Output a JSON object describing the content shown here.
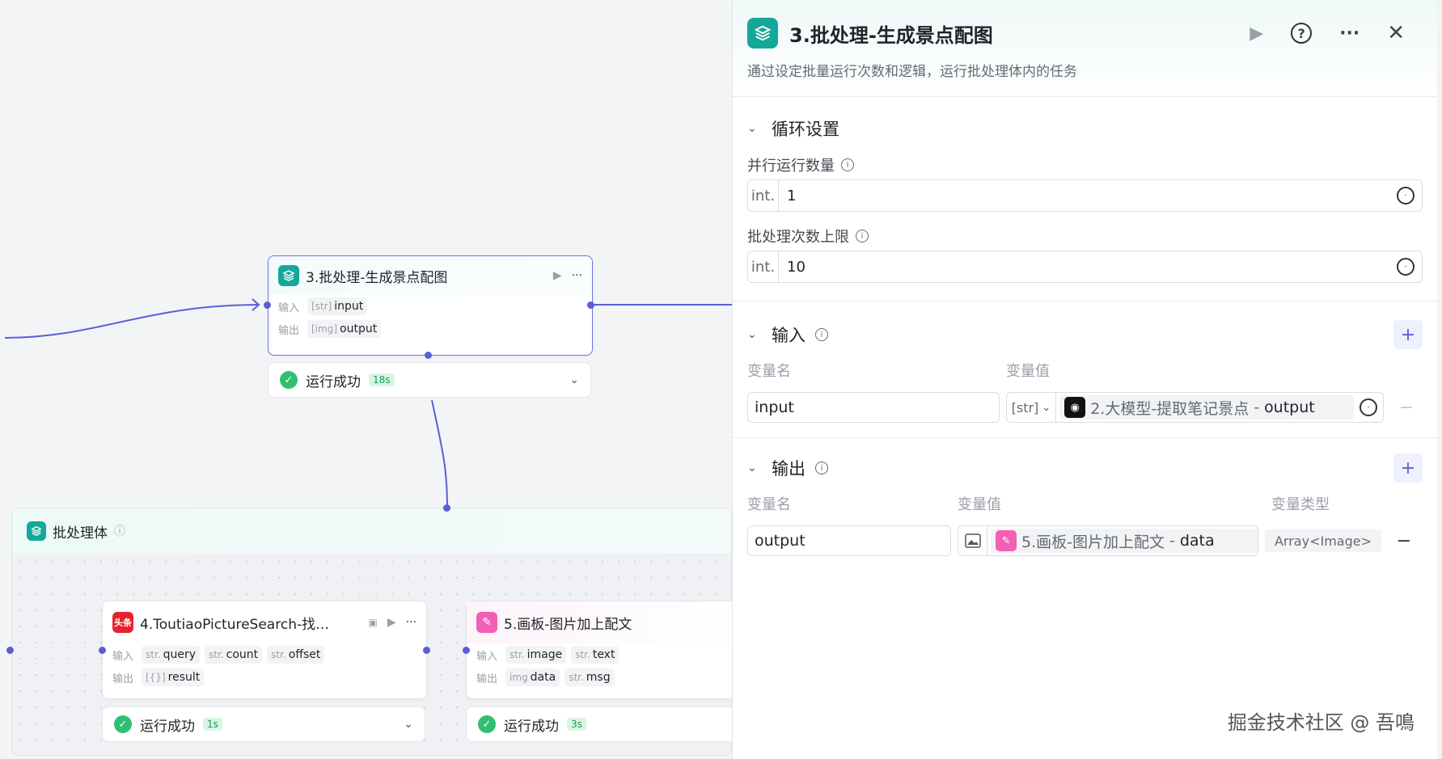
{
  "canvas": {
    "batch_node": {
      "title": "3.批处理-生成景点配图",
      "input_label": "输入",
      "input_chip": "input",
      "input_chip_type": "[str]",
      "output_label": "输出",
      "output_chip": "output",
      "output_chip_type": "[img]"
    },
    "batch_status": {
      "text": "运行成功",
      "time": "18s"
    },
    "batch_container": {
      "title": "批处理体"
    },
    "node4": {
      "title": "4.ToutiaoPictureSearch-找…",
      "icon_text": "头条",
      "input_label": "输入",
      "inputs": [
        {
          "type": "str.",
          "name": "query"
        },
        {
          "type": "str.",
          "name": "count"
        },
        {
          "type": "str.",
          "name": "offset"
        }
      ],
      "output_label": "输出",
      "outputs": [
        {
          "type": "[{}]",
          "name": "result"
        }
      ]
    },
    "node4_status": {
      "text": "运行成功",
      "time": "1s"
    },
    "node5": {
      "title": "5.画板-图片加上配文",
      "input_label": "输入",
      "inputs": [
        {
          "type": "str.",
          "name": "image"
        },
        {
          "type": "str.",
          "name": "text"
        }
      ],
      "output_label": "输出",
      "outputs": [
        {
          "type": "img",
          "name": "data"
        },
        {
          "type": "str.",
          "name": "msg"
        }
      ]
    },
    "node5_status": {
      "text": "运行成功",
      "time": "3s"
    }
  },
  "panel": {
    "title": "3.批处理-生成景点配图",
    "description": "通过设定批量运行次数和逻辑，运行批处理体内的任务",
    "loop_section": {
      "title": "循环设置",
      "parallel_label": "并行运行数量",
      "parallel_type": "int.",
      "parallel_value": "1",
      "limit_label": "批处理次数上限",
      "limit_type": "int.",
      "limit_value": "10"
    },
    "input_section": {
      "title": "输入",
      "col_name": "变量名",
      "col_value": "变量值",
      "row": {
        "name": "input",
        "type": "[str]",
        "ref_node": "2.大模型-提取笔记景点",
        "ref_sep": "-",
        "ref_var": "output"
      }
    },
    "output_section": {
      "title": "输出",
      "col_name": "变量名",
      "col_value": "变量值",
      "col_type": "变量类型",
      "row": {
        "name": "output",
        "ref_node": "5.画板-图片加上配文",
        "ref_sep": "-",
        "ref_var": "data",
        "var_type": "Array<Image>"
      }
    }
  },
  "watermark": "掘金技术社区 @ 吾鳴",
  "colors": {
    "accent": "#5a5fd6",
    "teal": "#14a89a",
    "success": "#2fbf71",
    "pink": "#f25fb5"
  }
}
